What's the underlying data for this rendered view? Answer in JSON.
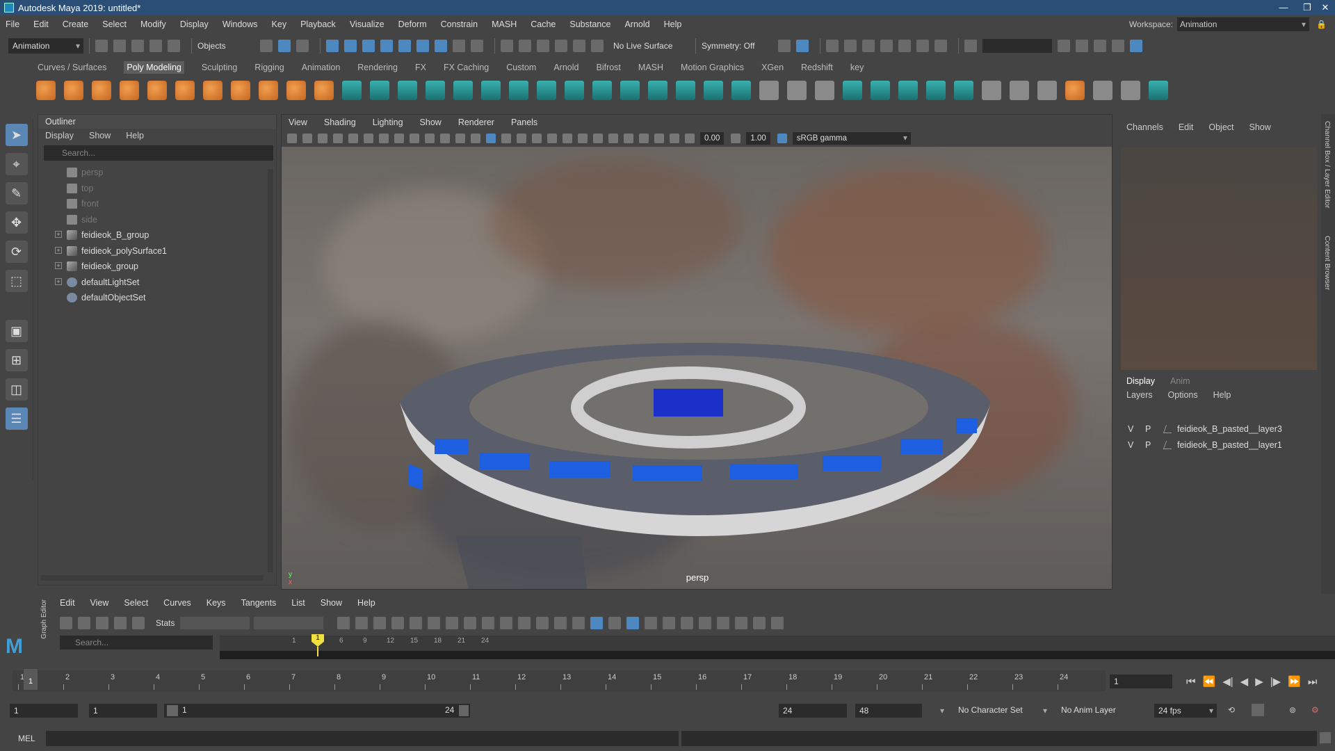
{
  "window": {
    "title": "Autodesk Maya 2019: untitled*",
    "controls": [
      "—",
      "❐",
      "✕"
    ]
  },
  "menu": [
    "File",
    "Edit",
    "Create",
    "Select",
    "Modify",
    "Display",
    "Windows",
    "Key",
    "Playback",
    "Visualize",
    "Deform",
    "Constrain",
    "MASH",
    "Cache",
    "Substance",
    "Arnold",
    "Help"
  ],
  "workspace": {
    "label": "Workspace:",
    "value": "Animation"
  },
  "status": {
    "menuset": "Animation",
    "objects": "Objects",
    "live_surface": "No Live Surface",
    "symmetry": "Symmetry: Off"
  },
  "shelf_tabs": [
    "Curves / Surfaces",
    "Poly Modeling",
    "Sculpting",
    "Rigging",
    "Animation",
    "Rendering",
    "FX",
    "FX Caching",
    "Custom",
    "Arnold",
    "Bifrost",
    "MASH",
    "Motion Graphics",
    "XGen",
    "Redshift",
    "key"
  ],
  "outliner": {
    "title": "Outliner",
    "menu": [
      "Display",
      "Show",
      "Help"
    ],
    "search_placeholder": "Search...",
    "items": [
      {
        "label": "persp",
        "type": "camera"
      },
      {
        "label": "top",
        "type": "camera"
      },
      {
        "label": "front",
        "type": "camera"
      },
      {
        "label": "side",
        "type": "camera"
      },
      {
        "label": "feidieok_B_group",
        "type": "group"
      },
      {
        "label": "feidieok_polySurface1",
        "type": "mesh"
      },
      {
        "label": "feidieok_group",
        "type": "group"
      },
      {
        "label": "defaultLightSet",
        "type": "set"
      },
      {
        "label": "defaultObjectSet",
        "type": "set"
      }
    ]
  },
  "viewport": {
    "menu": [
      "View",
      "Shading",
      "Lighting",
      "Show",
      "Renderer",
      "Panels"
    ],
    "exposure": "0.00",
    "gamma": "1.00",
    "colorspace": "sRGB gamma",
    "camera_label": "persp"
  },
  "channelbox": {
    "menu": [
      "Channels",
      "Edit",
      "Object",
      "Show"
    ],
    "layer_tabs": [
      "Display",
      "Anim"
    ],
    "layer_menu": [
      "Layers",
      "Options",
      "Help"
    ],
    "layers": [
      {
        "v": "V",
        "p": "P",
        "name": "feidieok_B_pasted__layer3"
      },
      {
        "v": "V",
        "p": "P",
        "name": "feidieok_B_pasted__layer1"
      }
    ]
  },
  "side_tabs": [
    "Channel Box / Layer Editor",
    "Content Browser"
  ],
  "graph_editor": {
    "label": "Graph Editor",
    "menu": [
      "Edit",
      "View",
      "Select",
      "Curves",
      "Keys",
      "Tangents",
      "List",
      "Show",
      "Help"
    ],
    "stats_label": "Stats",
    "search_placeholder": "Search...",
    "ruler": [
      "1",
      "3",
      "6",
      "9",
      "12",
      "15",
      "18",
      "21",
      "24"
    ]
  },
  "timeline": {
    "ticks": [
      "1",
      "2",
      "3",
      "4",
      "5",
      "6",
      "7",
      "8",
      "9",
      "10",
      "11",
      "12",
      "13",
      "14",
      "15",
      "16",
      "17",
      "18",
      "19",
      "20",
      "21",
      "22",
      "23",
      "24"
    ],
    "current": "1"
  },
  "range": {
    "start": "1",
    "start2": "1",
    "slider_start": "1",
    "slider_end": "24",
    "end": "24",
    "end2": "48",
    "character_set": "No Character Set",
    "anim_layer": "No Anim Layer",
    "fps": "24 fps"
  },
  "mel": {
    "label": "MEL"
  }
}
